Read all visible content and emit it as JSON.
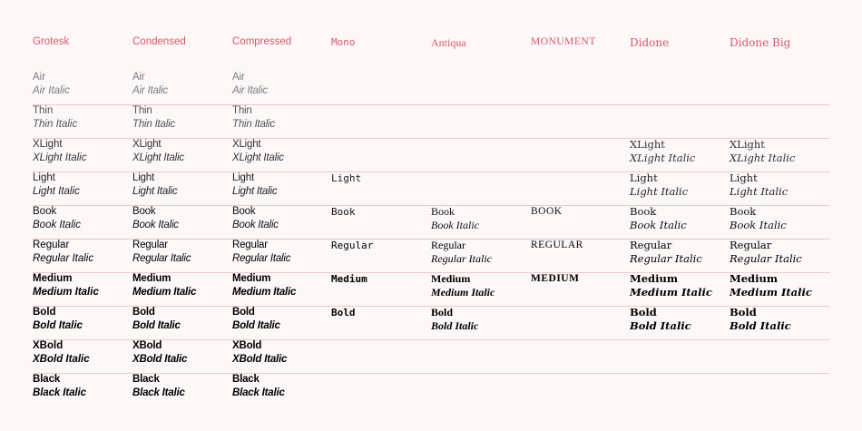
{
  "columns": [
    "Grotesk",
    "Condensed",
    "Compressed",
    "Mono",
    "Antiqua",
    "MONUMENT",
    "Didone",
    "Didone Big"
  ],
  "rows": [
    {
      "grotesk": [
        "Air",
        "Air Italic"
      ],
      "condensed": [
        "Air",
        "Air Italic"
      ],
      "compressed": [
        "Air",
        "Air Italic"
      ]
    },
    {
      "grotesk": [
        "Thin",
        "Thin Italic"
      ],
      "condensed": [
        "Thin",
        "Thin Italic"
      ],
      "compressed": [
        "Thin",
        "Thin Italic"
      ]
    },
    {
      "grotesk": [
        "XLight",
        "XLight Italic"
      ],
      "condensed": [
        "XLight",
        "XLight Italic"
      ],
      "compressed": [
        "XLight",
        "XLight Italic"
      ],
      "didone": [
        "XLight",
        "XLight Italic"
      ],
      "didone_big": [
        "XLight",
        "XLight Italic"
      ]
    },
    {
      "grotesk": [
        "Light",
        "Light Italic"
      ],
      "condensed": [
        "Light",
        "Light Italic"
      ],
      "compressed": [
        "Light",
        "Light Italic"
      ],
      "mono": [
        "Light"
      ],
      "didone": [
        "Light",
        "Light Italic"
      ],
      "didone_big": [
        "Light",
        "Light Italic"
      ]
    },
    {
      "grotesk": [
        "Book",
        "Book Italic"
      ],
      "condensed": [
        "Book",
        "Book Italic"
      ],
      "compressed": [
        "Book",
        "Book Italic"
      ],
      "mono": [
        "Book"
      ],
      "antiqua": [
        "Book",
        "Book Italic"
      ],
      "monument": [
        "BOOK"
      ],
      "didone": [
        "Book",
        "Book Italic"
      ],
      "didone_big": [
        "Book",
        "Book Italic"
      ]
    },
    {
      "grotesk": [
        "Regular",
        "Regular Italic"
      ],
      "condensed": [
        "Regular",
        "Regular Italic"
      ],
      "compressed": [
        "Regular",
        "Regular Italic"
      ],
      "mono": [
        "Regular"
      ],
      "antiqua": [
        "Regular",
        "Regular Italic"
      ],
      "monument": [
        "REGULAR"
      ],
      "didone": [
        "Regular",
        "Regular Italic"
      ],
      "didone_big": [
        "Regular",
        "Regular Italic"
      ]
    },
    {
      "grotesk": [
        "Medium",
        "Medium Italic"
      ],
      "condensed": [
        "Medium",
        "Medium Italic"
      ],
      "compressed": [
        "Medium",
        "Medium Italic"
      ],
      "mono": [
        "Medium"
      ],
      "antiqua": [
        "Medium",
        "Medium Italic"
      ],
      "monument": [
        "MEDIUM"
      ],
      "didone": [
        "Medium",
        "Medium Italic"
      ],
      "didone_big": [
        "Medium",
        "Medium Italic"
      ]
    },
    {
      "grotesk": [
        "Bold",
        "Bold Italic"
      ],
      "condensed": [
        "Bold",
        "Bold Italic"
      ],
      "compressed": [
        "Bold",
        "Bold Italic"
      ],
      "mono": [
        "Bold"
      ],
      "antiqua": [
        "Bold",
        "Bold Italic"
      ],
      "didone": [
        "Bold",
        "Bold Italic"
      ],
      "didone_big": [
        "Bold",
        "Bold Italic"
      ]
    },
    {
      "grotesk": [
        "XBold",
        "XBold Italic"
      ],
      "condensed": [
        "XBold",
        "XBold Italic"
      ],
      "compressed": [
        "XBold",
        "XBold Italic"
      ]
    },
    {
      "grotesk": [
        "Black",
        "Black Italic"
      ],
      "condensed": [
        "Black",
        "Black Italic"
      ],
      "compressed": [
        "Black",
        "Black Italic"
      ]
    }
  ],
  "colors": {
    "background": "#fdf7f7",
    "header": "#d8586a",
    "divider": "#ecc9cf"
  }
}
